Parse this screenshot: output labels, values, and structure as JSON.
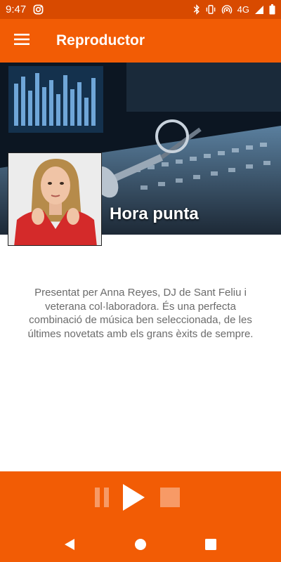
{
  "status_bar": {
    "time": "9:47",
    "network": "4G",
    "icons": [
      "instagram-icon",
      "bluetooth-icon",
      "vibrate-icon",
      "hotspot-icon",
      "signal-icon",
      "battery-icon"
    ]
  },
  "app_bar": {
    "title": "Reproductor",
    "menu_icon": "hamburger-menu-icon"
  },
  "program": {
    "title": "Hora punta",
    "description": "Presentat per Anna Reyes, DJ de Sant Feliu i veterana col·laboradora. És una perfecta combinació de música ben seleccionada, de les últimes novetats amb els grans èxits de sempre."
  },
  "player": {
    "controls": [
      "pause-icon",
      "play-icon",
      "stop-icon"
    ]
  },
  "nav_bar": {
    "buttons": [
      "back-icon",
      "home-icon",
      "recents-icon"
    ]
  },
  "colors": {
    "status_bar": "#d84a00",
    "app_bar": "#f25c05",
    "player_bar": "#f25c05",
    "description_text": "#6b6b6b",
    "inactive_control": "#f79a66"
  }
}
